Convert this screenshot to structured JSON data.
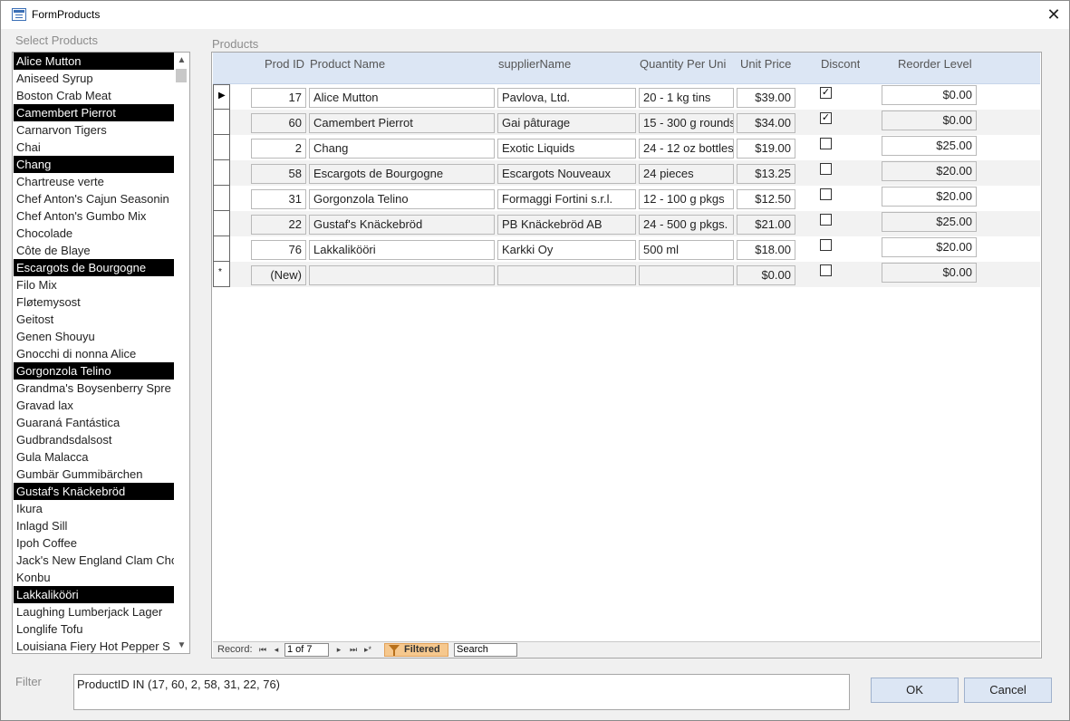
{
  "window": {
    "title": "FormProducts",
    "close_glyph": "✕"
  },
  "list": {
    "label": "Select Products",
    "items": [
      {
        "label": "Alice Mutton",
        "selected": true
      },
      {
        "label": "Aniseed Syrup",
        "selected": false
      },
      {
        "label": "Boston Crab Meat",
        "selected": false
      },
      {
        "label": "Camembert Pierrot",
        "selected": true
      },
      {
        "label": "Carnarvon Tigers",
        "selected": false
      },
      {
        "label": "Chai",
        "selected": false
      },
      {
        "label": "Chang",
        "selected": true
      },
      {
        "label": "Chartreuse verte",
        "selected": false
      },
      {
        "label": "Chef Anton's Cajun Seasonin",
        "selected": false
      },
      {
        "label": "Chef Anton's Gumbo Mix",
        "selected": false
      },
      {
        "label": "Chocolade",
        "selected": false
      },
      {
        "label": "Côte de Blaye",
        "selected": false
      },
      {
        "label": "Escargots de Bourgogne",
        "selected": true
      },
      {
        "label": "Filo Mix",
        "selected": false
      },
      {
        "label": "Fløtemysost",
        "selected": false
      },
      {
        "label": "Geitost",
        "selected": false
      },
      {
        "label": "Genen Shouyu",
        "selected": false
      },
      {
        "label": "Gnocchi di nonna Alice",
        "selected": false
      },
      {
        "label": "Gorgonzola Telino",
        "selected": true
      },
      {
        "label": "Grandma's Boysenberry Spre",
        "selected": false
      },
      {
        "label": "Gravad lax",
        "selected": false
      },
      {
        "label": "Guaraná Fantástica",
        "selected": false
      },
      {
        "label": "Gudbrandsdalsost",
        "selected": false
      },
      {
        "label": "Gula Malacca",
        "selected": false
      },
      {
        "label": "Gumbär Gummibärchen",
        "selected": false
      },
      {
        "label": "Gustaf's Knäckebröd",
        "selected": true
      },
      {
        "label": "Ikura",
        "selected": false
      },
      {
        "label": "Inlagd Sill",
        "selected": false
      },
      {
        "label": "Ipoh Coffee",
        "selected": false
      },
      {
        "label": "Jack's New England Clam Cho",
        "selected": false
      },
      {
        "label": "Konbu",
        "selected": false
      },
      {
        "label": "Lakkalikööri",
        "selected": true
      },
      {
        "label": "Laughing Lumberjack Lager",
        "selected": false
      },
      {
        "label": "Longlife Tofu",
        "selected": false
      },
      {
        "label": "Louisiana Fiery Hot Pepper S",
        "selected": false
      }
    ]
  },
  "subform": {
    "label": "Products",
    "columns": {
      "prod_id": "Prod ID",
      "product_name": "Product Name",
      "supplier": "supplierName",
      "qty": "Quantity Per Uni",
      "price": "Unit Price",
      "discont": "Discont",
      "reorder": "Reorder Level"
    },
    "rows": [
      {
        "id": "17",
        "name": "Alice Mutton",
        "supplier": "Pavlova, Ltd.",
        "qty": "20 - 1 kg tins",
        "price": "$39.00",
        "discont": true,
        "reorder": "$0.00",
        "marker": "▶"
      },
      {
        "id": "60",
        "name": "Camembert Pierrot",
        "supplier": "Gai pâturage",
        "qty": "15 - 300 g rounds",
        "price": "$34.00",
        "discont": true,
        "reorder": "$0.00",
        "marker": ""
      },
      {
        "id": "2",
        "name": "Chang",
        "supplier": "Exotic Liquids",
        "qty": "24 - 12 oz bottles",
        "price": "$19.00",
        "discont": false,
        "reorder": "$25.00",
        "marker": ""
      },
      {
        "id": "58",
        "name": "Escargots de Bourgogne",
        "supplier": "Escargots Nouveaux",
        "qty": "24 pieces",
        "price": "$13.25",
        "discont": false,
        "reorder": "$20.00",
        "marker": ""
      },
      {
        "id": "31",
        "name": "Gorgonzola Telino",
        "supplier": "Formaggi Fortini s.r.l.",
        "qty": "12 - 100 g pkgs",
        "price": "$12.50",
        "discont": false,
        "reorder": "$20.00",
        "marker": ""
      },
      {
        "id": "22",
        "name": "Gustaf's Knäckebröd",
        "supplier": "PB Knäckebröd AB",
        "qty": "24 - 500 g pkgs.",
        "price": "$21.00",
        "discont": false,
        "reorder": "$25.00",
        "marker": ""
      },
      {
        "id": "76",
        "name": "Lakkalikööri",
        "supplier": "Karkki Oy",
        "qty": "500 ml",
        "price": "$18.00",
        "discont": false,
        "reorder": "$20.00",
        "marker": ""
      },
      {
        "id": "(New)",
        "name": "",
        "supplier": "",
        "qty": "",
        "price": "$0.00",
        "discont": false,
        "reorder": "$0.00",
        "marker": "*"
      }
    ],
    "nav": {
      "record_label": "Record:",
      "record_value": "1 of 7",
      "filtered_label": "Filtered",
      "search_label": "Search"
    }
  },
  "filter": {
    "label": "Filter",
    "value": "ProductID IN (17, 60, 2, 58, 31, 22, 76)"
  },
  "buttons": {
    "ok": "OK",
    "cancel": "Cancel"
  }
}
